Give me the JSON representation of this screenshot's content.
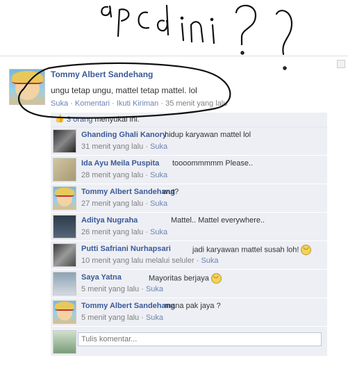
{
  "post": {
    "author": "Tommy Albert Sandehang",
    "text": "ungu tetap ungu, mattel tetap mattel. lol",
    "actions": [
      "Suka",
      "Komentari",
      "Ikuti Kiriman"
    ],
    "separator": " · ",
    "time": "35 menit yang lalu"
  },
  "likes": {
    "count_label": "3 orang",
    "suffix": " menyukai ini."
  },
  "comments": [
    {
      "author": "Ghanding Ghali Kanory",
      "text": "hidup karyawan mattel lol",
      "time": "31 menit yang lalu",
      "like": "Suka",
      "avatar": "dark1"
    },
    {
      "author": "Ida Ayu Meila Puspita",
      "text": "toooommmmm Please..",
      "time": "28 menit yang lalu",
      "like": "Suka",
      "avatar": "tan"
    },
    {
      "author": "Tommy Albert Sandehang",
      "text": "wut?",
      "time": "27 menit yang lalu",
      "like": "Suka",
      "avatar": "luffy"
    },
    {
      "author": "Aditya Nugraha",
      "text": "Mattel.. Mattel everywhere..",
      "time": "26 menit yang lalu",
      "like": "Suka",
      "avatar": "dark2"
    },
    {
      "author": "Putti Safriani Nurhapsari",
      "text": "jadi karyawan mattel susah loh!",
      "time": "10 menit yang lalu melalui seluler",
      "like": "Suka",
      "avatar": "gray",
      "emoticon": "smile"
    },
    {
      "author": "Saya Yatna",
      "text": "Mayoritas berjaya",
      "time": "5 menit yang lalu",
      "like": "Suka",
      "avatar": "sky",
      "emoticon": "smile"
    },
    {
      "author": "Tommy Albert Sandehang",
      "text": "mana pak jaya ?",
      "time": "5 menit yang lalu",
      "like": "Suka",
      "avatar": "luffy"
    }
  ],
  "composer": {
    "placeholder": "Tulis komentar..."
  },
  "handwriting": "apa ini ? ?"
}
